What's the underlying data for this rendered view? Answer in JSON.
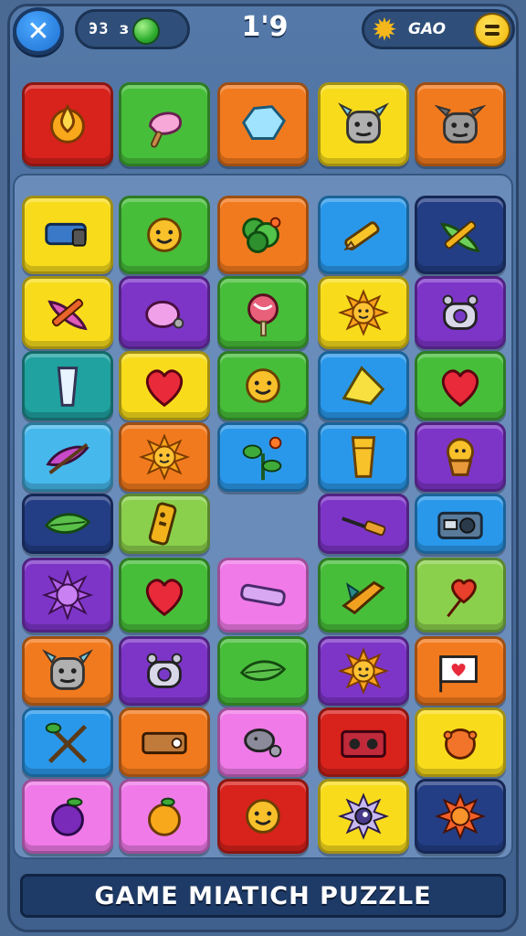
{
  "top_bar": {
    "left_counter": "ЭЗ ɜ",
    "center_value": "1'9",
    "right_label": "GAO"
  },
  "footer": {
    "title": "GAME MIATICH  PUZZLE"
  },
  "colors": {
    "red": "#d8221c",
    "green": "#47be3a",
    "orange": "#f27a1e",
    "yellow": "#f8dc1c",
    "blue": "#2a98ea",
    "purple": "#7d35c8",
    "pink": "#f07ae8",
    "teal": "#1fa2a0",
    "lime": "#8bd04c",
    "lightblue": "#46b8ec",
    "darkblue": "#233e85"
  },
  "rows": [
    [
      {
        "color": "red",
        "icon": "drop-sun-icon"
      },
      {
        "color": "green",
        "icon": "ice-cream-icon"
      },
      {
        "color": "orange",
        "icon": "crystal-icon"
      },
      {
        "color": "yellow",
        "icon": "robot-face-icon"
      },
      {
        "color": "orange",
        "icon": "monster-face-icon"
      }
    ],
    [
      {
        "color": "yellow",
        "icon": "projector-icon"
      },
      {
        "color": "green",
        "icon": "smiley-face-icon"
      },
      {
        "color": "orange",
        "icon": "leaf-bunch-icon"
      },
      {
        "color": "blue",
        "icon": "pencil-icon"
      },
      {
        "color": "darkblue",
        "icon": "pencil-leaf-icon"
      }
    ],
    [
      {
        "color": "yellow",
        "icon": "brush-icon"
      },
      {
        "color": "purple",
        "icon": "whistle-icon"
      },
      {
        "color": "green",
        "icon": "lollipop-icon"
      },
      {
        "color": "yellow",
        "icon": "sun-icon"
      },
      {
        "color": "purple",
        "icon": "robot-toy-icon"
      }
    ],
    [
      {
        "color": "teal",
        "icon": "glass-icon"
      },
      {
        "color": "yellow",
        "icon": "heart-icon"
      },
      {
        "color": "green",
        "icon": "smiley-face-icon"
      },
      {
        "color": "blue",
        "icon": "cheese-icon"
      },
      {
        "color": "green",
        "icon": "heart-icon"
      }
    ],
    [
      {
        "color": "lightblue",
        "icon": "feather-pen-icon"
      },
      {
        "color": "orange",
        "icon": "sun-icon"
      },
      {
        "color": "blue",
        "icon": "flower-icon"
      },
      {
        "color": "blue",
        "icon": "cup-icon"
      },
      {
        "color": "purple",
        "icon": "cupcake-icon"
      }
    ],
    [
      {
        "color": "darkblue",
        "icon": "leaf-icon"
      },
      {
        "color": "lime",
        "icon": "remote-icon"
      },
      {
        "color": "blank",
        "icon": ""
      },
      {
        "color": "purple",
        "icon": "screwdriver-icon"
      },
      {
        "color": "blue",
        "icon": "camera-icon"
      }
    ],
    [
      {
        "color": "purple",
        "icon": "spiky-ball-icon"
      },
      {
        "color": "green",
        "icon": "heart-icon"
      },
      {
        "color": "pink",
        "icon": "bar-icon"
      },
      {
        "color": "green",
        "icon": "rocket-icon"
      },
      {
        "color": "lime",
        "icon": "balloon-heart-icon"
      }
    ],
    [
      {
        "color": "orange",
        "icon": "robot-face-icon"
      },
      {
        "color": "purple",
        "icon": "robot-toy-icon"
      },
      {
        "color": "green",
        "icon": "leaf-icon"
      },
      {
        "color": "purple",
        "icon": "sun-icon"
      },
      {
        "color": "orange",
        "icon": "flag-heart-icon"
      }
    ],
    [
      {
        "color": "blue",
        "icon": "crossed-tools-icon"
      },
      {
        "color": "orange",
        "icon": "ticket-icon"
      },
      {
        "color": "pink",
        "icon": "snail-icon"
      },
      {
        "color": "red",
        "icon": "boombox-icon"
      },
      {
        "color": "yellow",
        "icon": "ball-icon"
      }
    ],
    [
      {
        "color": "pink",
        "icon": "plum-icon"
      },
      {
        "color": "pink",
        "icon": "peach-icon"
      },
      {
        "color": "red",
        "icon": "smiley-face-icon"
      },
      {
        "color": "yellow",
        "icon": "eyeball-icon"
      },
      {
        "color": "darkblue",
        "icon": "star-ball-icon"
      }
    ]
  ]
}
